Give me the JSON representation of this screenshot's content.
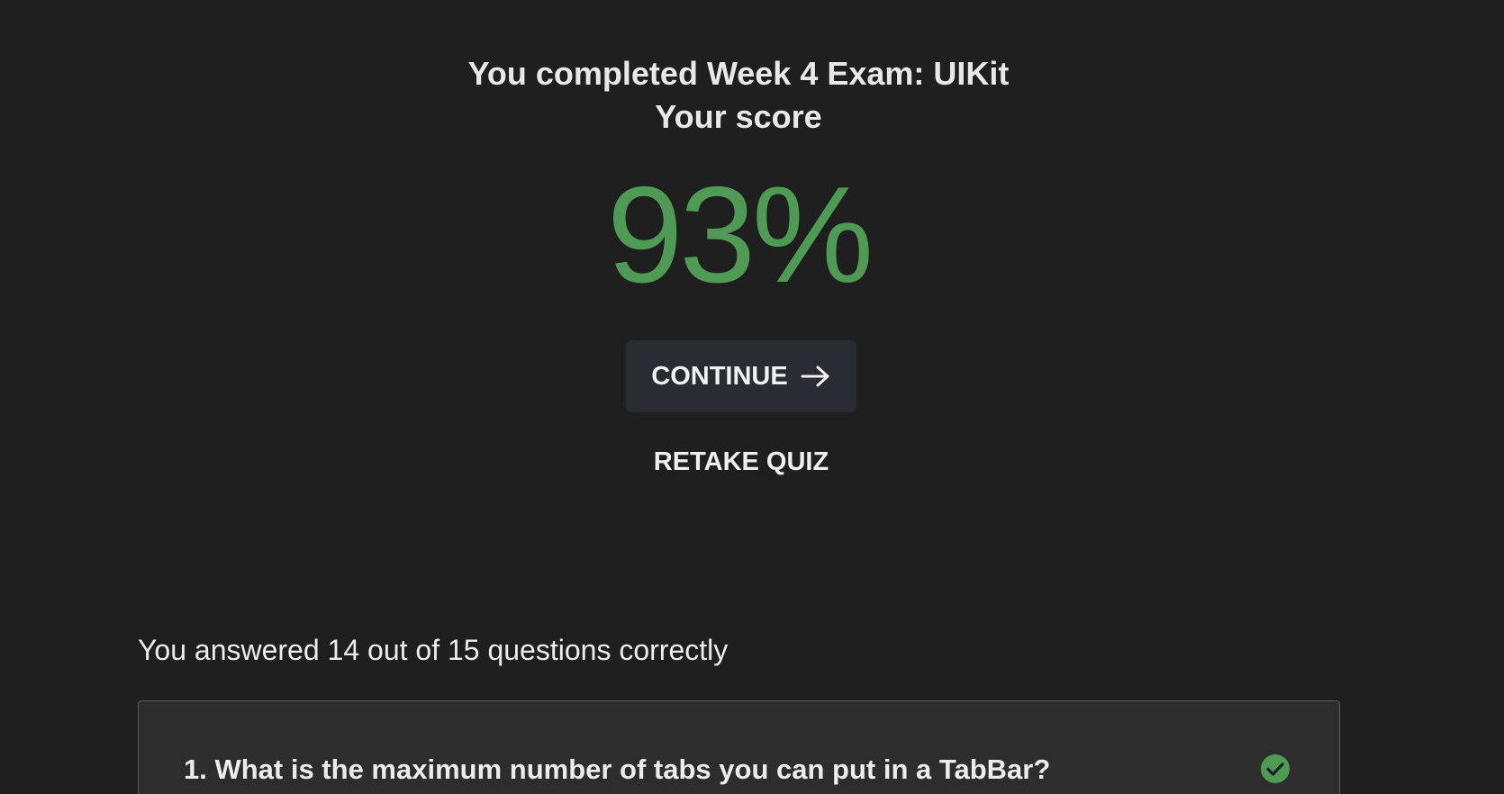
{
  "header": {
    "completed_text": "You completed Week 4 Exam: UIKit",
    "score_label": "Your score"
  },
  "score": {
    "value": "93%"
  },
  "actions": {
    "continue_label": "CONTINUE",
    "retake_label": "RETAKE QUIZ"
  },
  "results": {
    "summary": "You answered 14 out of 15 questions correctly",
    "questions": [
      {
        "text": "1. What is the maximum number of tabs you can put in a TabBar?",
        "status_icon": "check-circle-icon"
      }
    ]
  },
  "colors": {
    "background": "#1f1f1f",
    "score_green": "#4f9a54",
    "button_bg": "#2a2b33",
    "card_bg": "#2d2d2d",
    "card_border": "#5a5a5a"
  }
}
